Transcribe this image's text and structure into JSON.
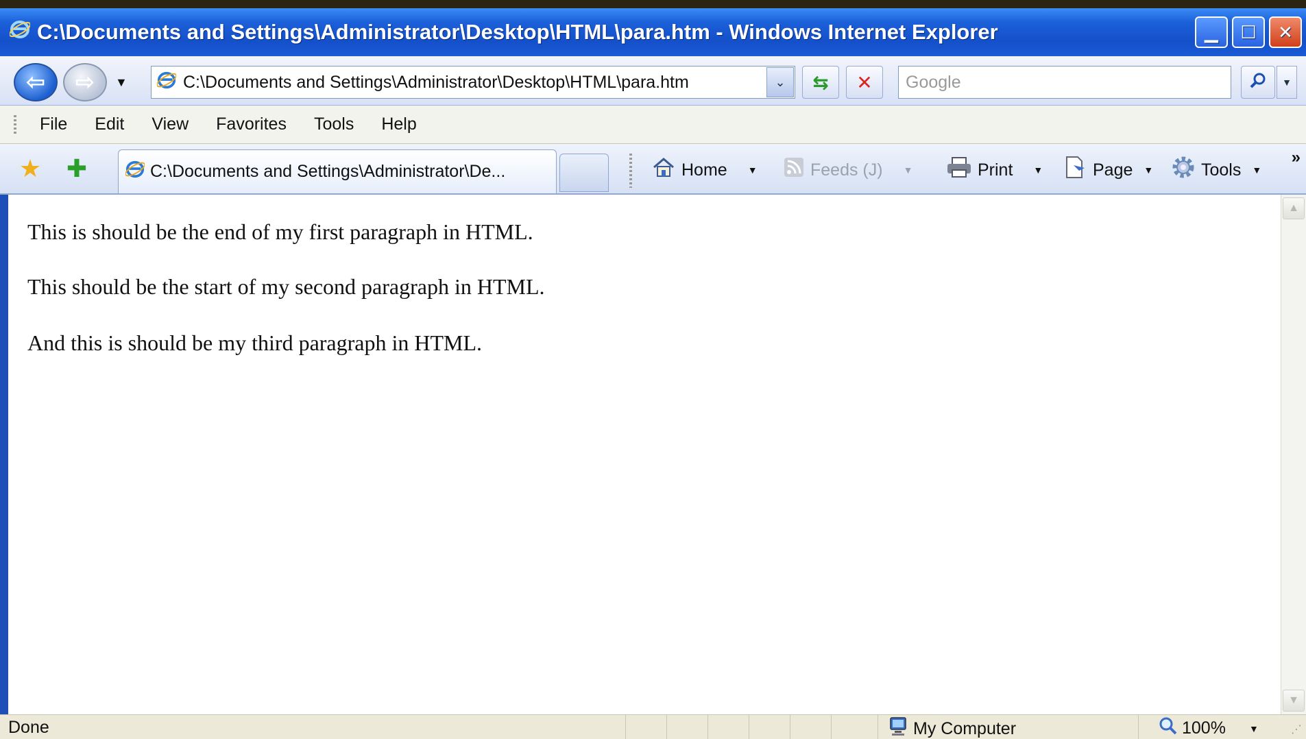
{
  "window": {
    "title": "C:\\Documents and Settings\\Administrator\\Desktop\\HTML\\para.htm - Windows Internet Explorer",
    "minimize_glyph": "▁",
    "maximize_glyph": "☐",
    "close_glyph": "✕"
  },
  "nav": {
    "back_glyph": "⇦",
    "forward_glyph": "⇨",
    "history_drop_glyph": "▼",
    "address_value": "C:\\Documents and Settings\\Administrator\\Desktop\\HTML\\para.htm",
    "address_drop_glyph": "⌄",
    "refresh_glyph": "⇆",
    "stop_glyph": "✕",
    "search_placeholder": "Google",
    "search_drop_glyph": "▼"
  },
  "menu": {
    "items": [
      "File",
      "Edit",
      "View",
      "Favorites",
      "Tools",
      "Help"
    ]
  },
  "tabs": {
    "active_tab_label": "C:\\Documents and Settings\\Administrator\\De...",
    "fav_star_glyph": "★",
    "add_fav_glyph": "✚"
  },
  "commands": {
    "home": "Home",
    "feeds": "Feeds (J)",
    "print": "Print",
    "page": "Page",
    "tools": "Tools",
    "more_glyph": "»",
    "drop_glyph": "▼"
  },
  "content": {
    "paragraphs": [
      "This is should be the end of my first paragraph in HTML.",
      "This should be the start of my second paragraph in HTML.",
      "And this is should be my third paragraph in HTML."
    ]
  },
  "status": {
    "text": "Done",
    "zone": "My Computer",
    "zoom": "100%",
    "zoom_drop_glyph": "▼"
  },
  "icons": {
    "ie": "ie-icon",
    "home": "home-icon",
    "feeds": "feeds-icon",
    "print": "printer-icon",
    "page": "page-icon",
    "tools": "gear-icon",
    "search": "search-icon",
    "computer": "computer-icon",
    "zoom": "zoom-icon"
  },
  "colors": {
    "titlebar": "#1450c9",
    "content_bg": "#ffffff",
    "chrome_bg": "#ece9d8"
  }
}
